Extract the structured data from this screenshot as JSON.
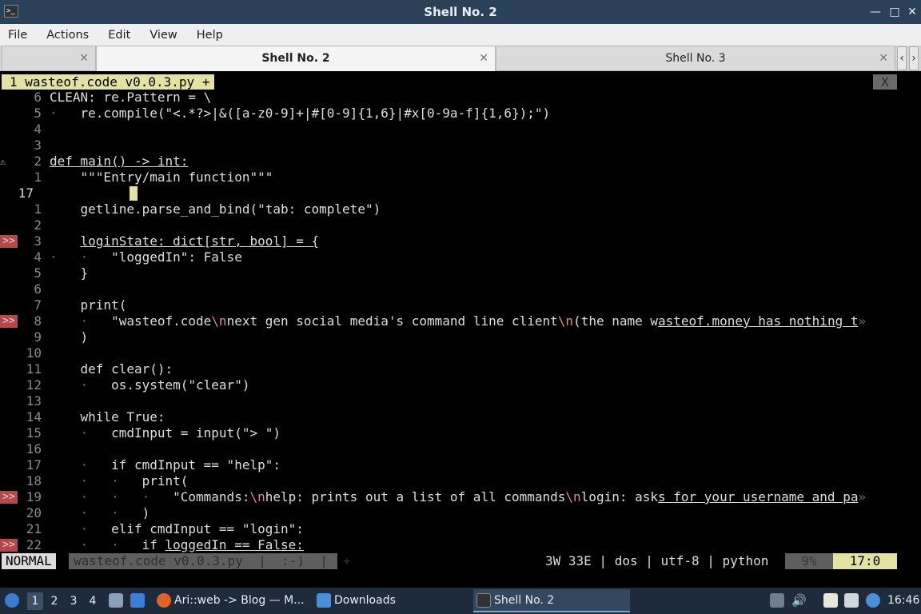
{
  "window": {
    "title": "Shell No. 2",
    "app_icon": ">_",
    "controls": [
      "—",
      "□",
      "✕"
    ]
  },
  "menu": [
    "File",
    "Actions",
    "Edit",
    "View",
    "Help"
  ],
  "tabs": [
    {
      "label": "",
      "close": "✕",
      "active": false
    },
    {
      "label": "Shell No. 2",
      "close": "✕",
      "active": true
    },
    {
      "label": "Shell No. 3",
      "close": "✕",
      "active": false
    }
  ],
  "tab_arrows": [
    "‹",
    "›"
  ],
  "editor": {
    "buffer_tab": "1 wasteof.code v0.0.3.py +",
    "close_buffer": "X",
    "current_line_number": "17",
    "lines": [
      {
        "sign": "",
        "ln": "6",
        "spans": [
          [
            "t",
            "CLEAN: re.Pattern = \\"
          ]
        ]
      },
      {
        "sign": "",
        "ln": "5",
        "spans": [
          [
            "i",
            "·   "
          ],
          [
            "t",
            "re.compile(\"<.*?>|&([a-z0-9]+|#[0-9]{1,6}|#x[0-9a-f]{1,6});\")"
          ]
        ]
      },
      {
        "sign": "",
        "ln": "4",
        "spans": []
      },
      {
        "sign": "",
        "ln": "3",
        "spans": []
      },
      {
        "sign": "⚠",
        "ln": "2",
        "spans": [
          [
            "u",
            "def main() -> int:"
          ]
        ]
      },
      {
        "sign": "",
        "ln": "1",
        "spans": [
          [
            "t",
            "    \"\"\"Entry/main function\"\"\""
          ]
        ]
      },
      {
        "sign": "",
        "ln": "17",
        "cur": true,
        "cursor": true,
        "spans": []
      },
      {
        "sign": "",
        "ln": "1",
        "spans": [
          [
            "t",
            "    getline.parse_and_bind(\"tab: complete\")"
          ]
        ]
      },
      {
        "sign": "",
        "ln": "2",
        "spans": []
      },
      {
        "sign": ">>",
        "ln": "3",
        "spans": [
          [
            "t",
            "    "
          ],
          [
            "u",
            "loginState: dict[str, bool] = {"
          ]
        ]
      },
      {
        "sign": "",
        "ln": "4",
        "spans": [
          [
            "i",
            "·   ·   "
          ],
          [
            "t",
            "\"loggedIn\": False"
          ]
        ]
      },
      {
        "sign": "",
        "ln": "5",
        "spans": [
          [
            "t",
            "    }"
          ]
        ]
      },
      {
        "sign": "",
        "ln": "6",
        "spans": []
      },
      {
        "sign": "",
        "ln": "7",
        "spans": [
          [
            "t",
            "    print("
          ]
        ]
      },
      {
        "sign": ">>",
        "ln": "8",
        "spans": [
          [
            "i",
            "    ·   "
          ],
          [
            "t",
            "\"wasteof.code"
          ],
          [
            "e",
            "\\n"
          ],
          [
            "t",
            "next gen social media's command line client"
          ],
          [
            "e",
            "\\n"
          ],
          [
            "t",
            "(the name w"
          ],
          [
            "u",
            "asteof.money has nothing t"
          ],
          [
            "i",
            "»"
          ]
        ]
      },
      {
        "sign": "",
        "ln": "9",
        "spans": [
          [
            "t",
            "    )"
          ]
        ]
      },
      {
        "sign": "",
        "ln": "10",
        "spans": []
      },
      {
        "sign": "",
        "ln": "11",
        "spans": [
          [
            "t",
            "    def clear():"
          ]
        ]
      },
      {
        "sign": "",
        "ln": "12",
        "spans": [
          [
            "i",
            "    ·   "
          ],
          [
            "t",
            "os.system(\"clear\")"
          ]
        ]
      },
      {
        "sign": "",
        "ln": "13",
        "spans": []
      },
      {
        "sign": "",
        "ln": "14",
        "spans": [
          [
            "t",
            "    while True:"
          ]
        ]
      },
      {
        "sign": "",
        "ln": "15",
        "spans": [
          [
            "i",
            "    ·   "
          ],
          [
            "t",
            "cmdInput = input(\"> \")"
          ]
        ]
      },
      {
        "sign": "",
        "ln": "16",
        "spans": []
      },
      {
        "sign": "",
        "ln": "17",
        "spans": [
          [
            "i",
            "    ·   "
          ],
          [
            "t",
            "if cmdInput == \"help\":"
          ]
        ]
      },
      {
        "sign": "",
        "ln": "18",
        "spans": [
          [
            "i",
            "    ·   ·   "
          ],
          [
            "t",
            "print("
          ]
        ]
      },
      {
        "sign": ">>",
        "ln": "19",
        "spans": [
          [
            "i",
            "    ·   ·   ·   "
          ],
          [
            "t",
            "\"Commands:"
          ],
          [
            "e",
            "\\n"
          ],
          [
            "t",
            "help: prints out a list of all commands"
          ],
          [
            "e",
            "\\n"
          ],
          [
            "t",
            "login: ask"
          ],
          [
            "u",
            "s for your username and pa"
          ],
          [
            "i",
            "»"
          ]
        ]
      },
      {
        "sign": "",
        "ln": "20",
        "spans": [
          [
            "i",
            "    ·   ·   "
          ],
          [
            "t",
            ")"
          ]
        ]
      },
      {
        "sign": "",
        "ln": "21",
        "spans": [
          [
            "i",
            "    ·   "
          ],
          [
            "t",
            "elif cmdInput == \"login\":"
          ]
        ]
      },
      {
        "sign": ">>",
        "ln": "22",
        "spans": [
          [
            "i",
            "    ·   ·   "
          ],
          [
            "t",
            "if "
          ],
          [
            "u",
            "loggedIn == False:"
          ]
        ]
      }
    ]
  },
  "statusline": {
    "mode": "NORMAL",
    "file": "wasteof.code v0.0.3.py  |  :-)  |  +",
    "right": "3W 33E | dos | utf-8 | python",
    "percent": "9%",
    "position": "17:0"
  },
  "taskbar": {
    "workspaces": [
      "1",
      "2",
      "3",
      "4"
    ],
    "active_workspace": "1",
    "tasks": [
      {
        "label": "Ari::web -> Blog — M...",
        "icon": "firefox-icon"
      },
      {
        "label": "Downloads",
        "icon": "folder-icon"
      },
      {
        "label": "Shell No. 2",
        "icon": "terminal-icon",
        "active": true
      }
    ],
    "clock": "16:46"
  }
}
